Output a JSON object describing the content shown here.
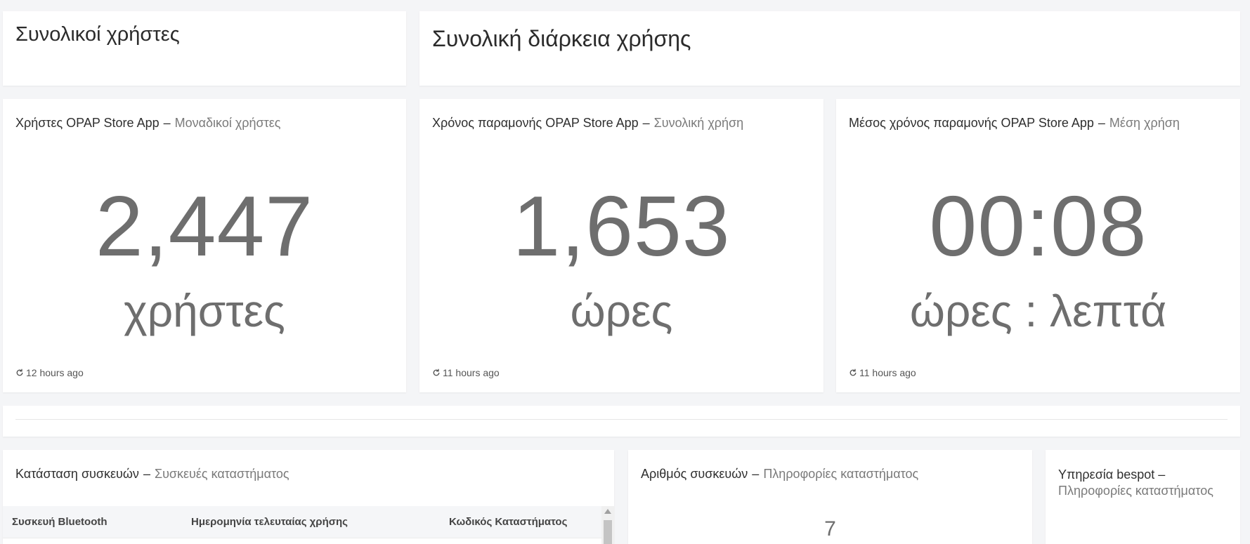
{
  "sections": {
    "users_title": "Συνολικοί χρήστες",
    "duration_title": "Συνολική διάρκεια χρήσης"
  },
  "kpi_users": {
    "title": "Χρήστες OPAP Store App",
    "separator": "–",
    "subtitle": "Μοναδικοί χρήστες",
    "value": "2,447",
    "unit": "χρήστες",
    "refreshed": "12 hours ago"
  },
  "kpi_time": {
    "title": "Χρόνος παραμονής OPAP Store App",
    "separator": "–",
    "subtitle": "Συνολική χρήση",
    "value": "1,653",
    "unit": "ώρες",
    "refreshed": "11 hours ago"
  },
  "kpi_avg": {
    "title": "Μέσος χρόνος παραμονής OPAP Store App",
    "separator": "–",
    "subtitle": "Μέση χρήση",
    "value": "00:08",
    "unit": "ώρες : λεπτά",
    "refreshed": "11 hours ago"
  },
  "devices_table": {
    "title": "Κατάσταση συσκευών",
    "separator": "–",
    "subtitle": "Συσκευές καταστήματος",
    "columns": [
      "Συσκευή Bluetooth",
      "Ημερομηνία τελευταίας χρήσης",
      "Κωδικός Καταστήματος"
    ]
  },
  "device_count": {
    "title": "Αριθμός συσκευών",
    "separator": "–",
    "subtitle": "Πληροφορίες καταστήματος",
    "value": "7"
  },
  "bespot": {
    "title": "Υπηρεσία bespot",
    "separator": "–",
    "subtitle": "Πληροφορίες καταστήματος"
  },
  "colors": {
    "background": "#f4f5f7",
    "card": "#ffffff",
    "value_text": "#6e6e6e",
    "subtitle_text": "#7a7a7a"
  },
  "icons": {
    "refresh": "refresh-icon"
  }
}
